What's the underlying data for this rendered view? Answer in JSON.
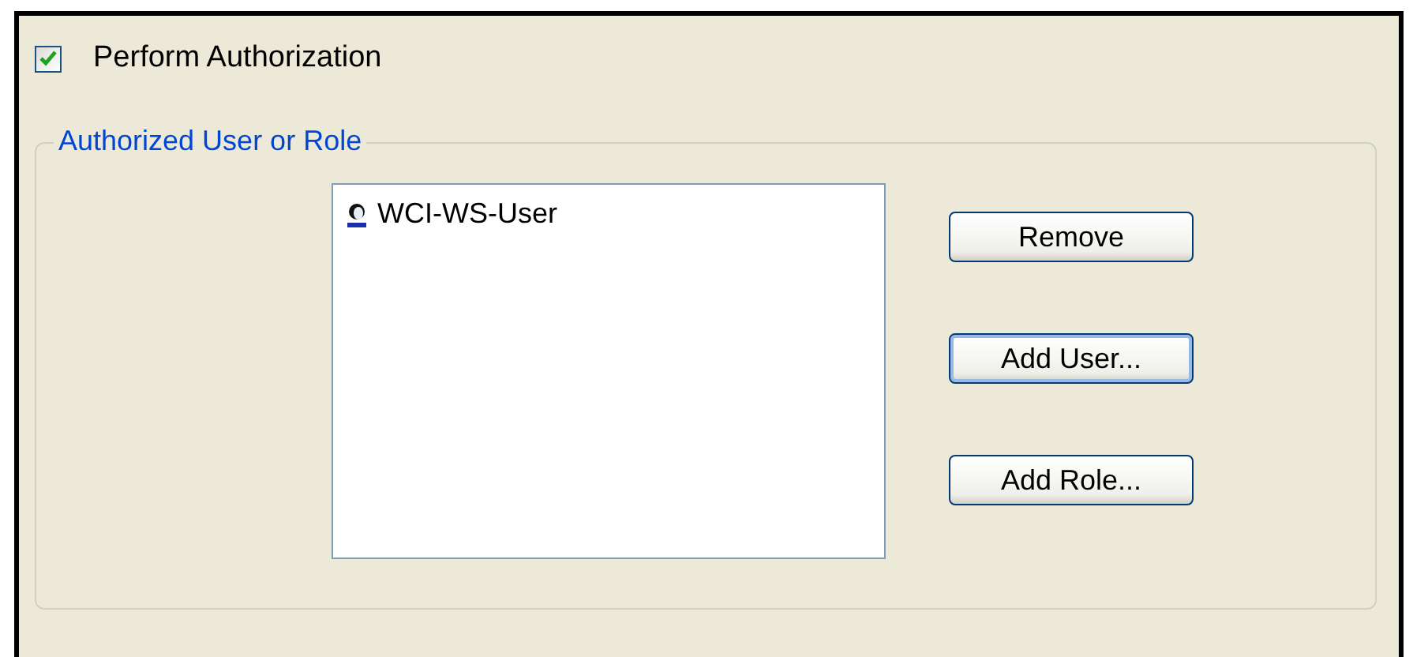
{
  "perform_authorization": {
    "label": "Perform Authorization",
    "checked": true
  },
  "group": {
    "title": "Authorized User or Role",
    "list_items": [
      {
        "label": "WCI-WS-User",
        "selected": false
      }
    ],
    "buttons": [
      {
        "label": "Remove",
        "focused": false
      },
      {
        "label": "Add User...",
        "focused": true
      },
      {
        "label": "Add Role...",
        "focused": false
      }
    ]
  }
}
